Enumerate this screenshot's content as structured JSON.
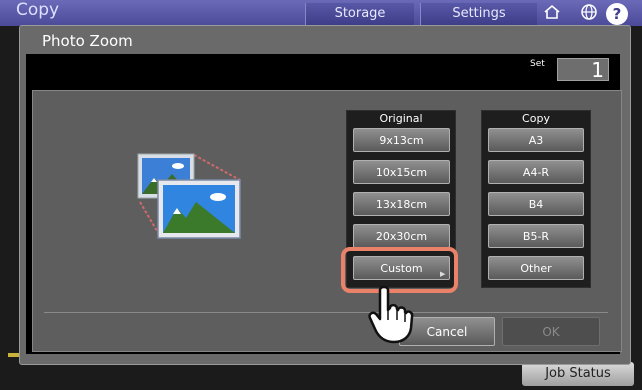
{
  "app": {
    "title": "Copy"
  },
  "header": {
    "tabs": [
      {
        "label": "Storage"
      },
      {
        "label": "Settings"
      }
    ],
    "help_symbol": "?"
  },
  "dialog": {
    "title": "Photo Zoom",
    "set_label": "Set",
    "set_value": "1",
    "original": {
      "title": "Original",
      "options": [
        {
          "label": "9x13cm"
        },
        {
          "label": "10x15cm"
        },
        {
          "label": "13x18cm"
        },
        {
          "label": "20x30cm"
        },
        {
          "label": "Custom"
        }
      ]
    },
    "copy": {
      "title": "Copy",
      "options": [
        {
          "label": "A3"
        },
        {
          "label": "A4-R"
        },
        {
          "label": "B4"
        },
        {
          "label": "B5-R"
        },
        {
          "label": "Other"
        }
      ]
    },
    "cancel_label": "Cancel",
    "ok_label": "OK"
  },
  "footer": {
    "job_status_label": "Job Status"
  },
  "colors": {
    "highlight": "#ea8169",
    "header": "#4a4a98",
    "dialog_bg": "#6a6a6a"
  },
  "icons": {
    "illustration": "photo-zoom-illustration-icon",
    "cursor": "pointing-hand-icon"
  }
}
